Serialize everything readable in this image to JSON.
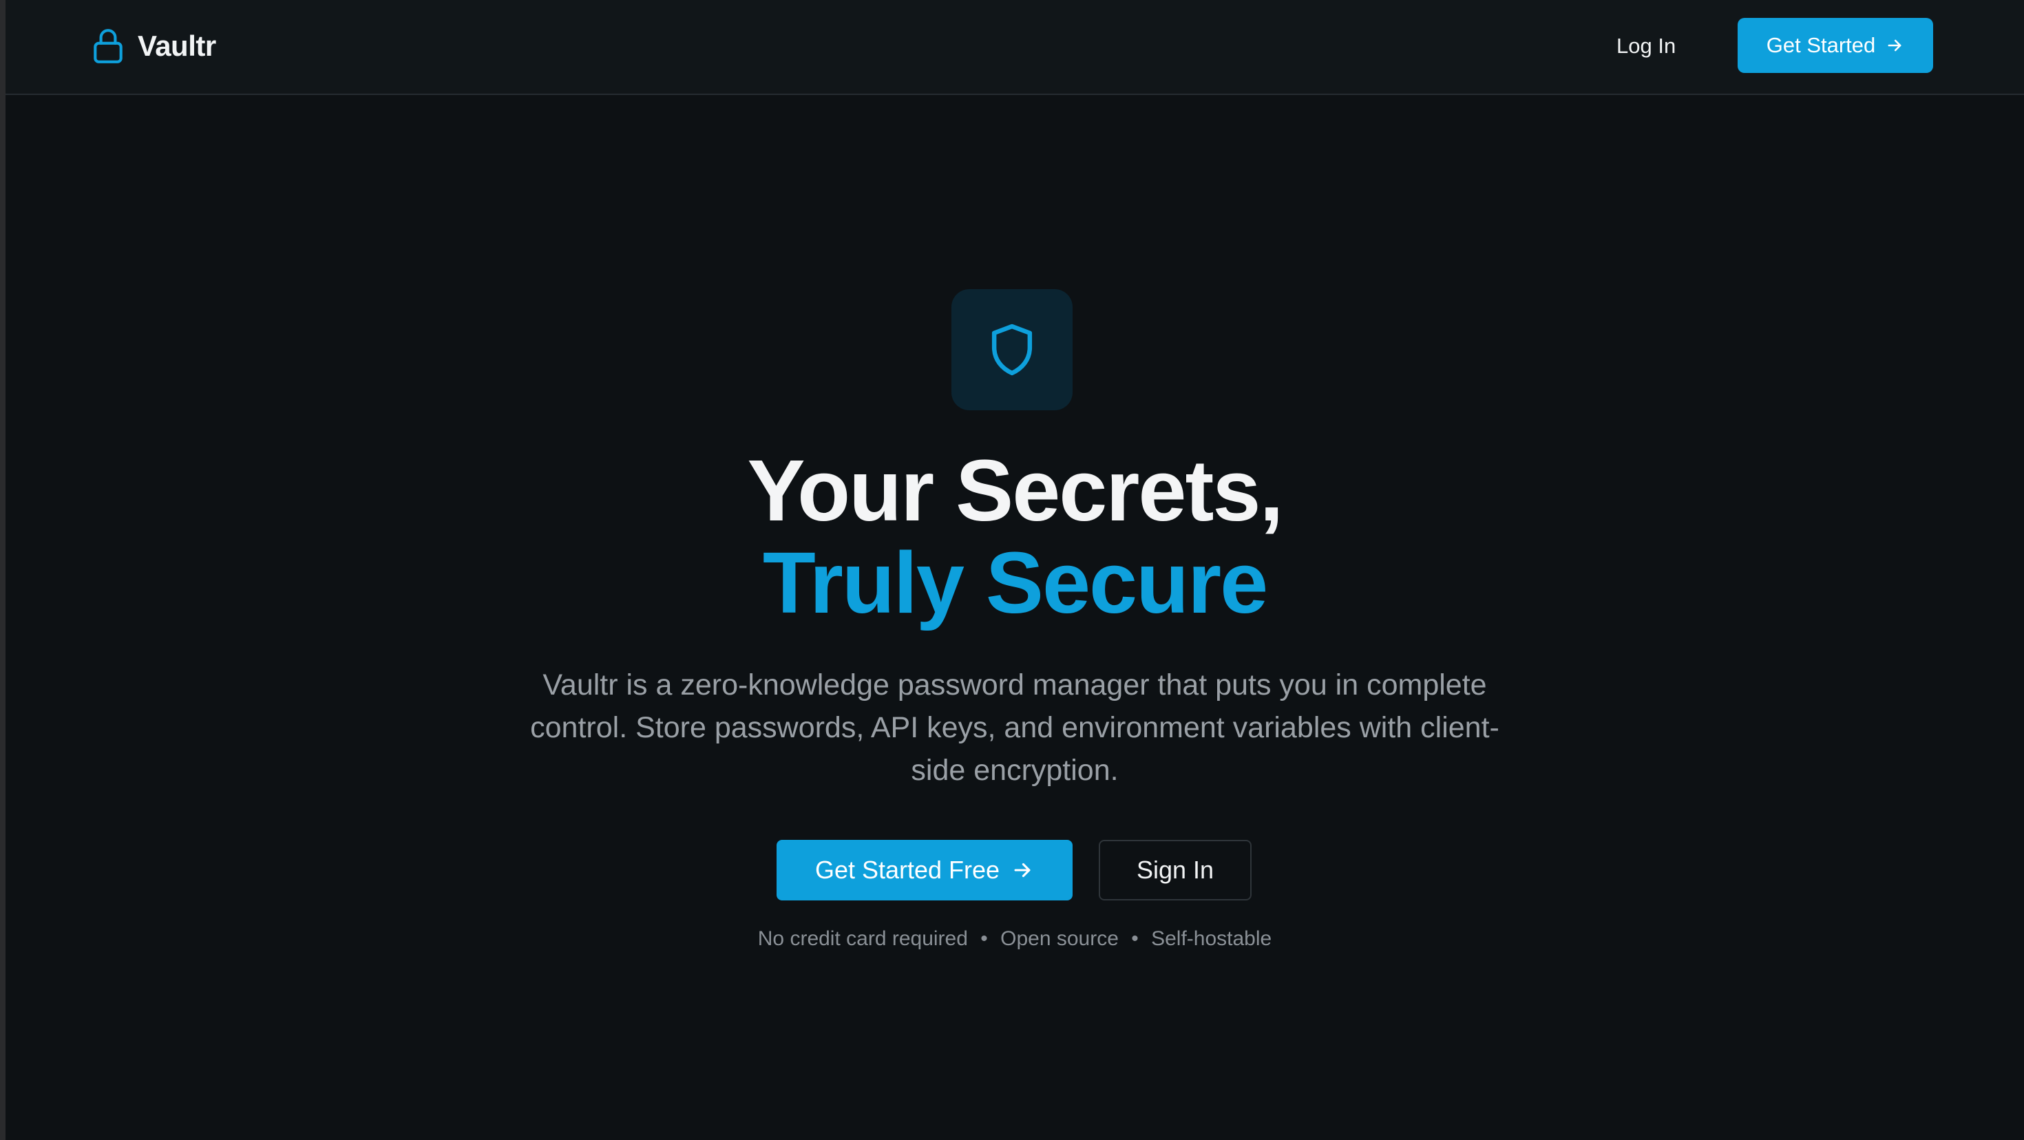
{
  "colors": {
    "accent": "#0ea0dc",
    "background": "#0d1114",
    "navbar": "#111619",
    "muted_text": "#9aa0a6"
  },
  "header": {
    "brand_icon": "lock-icon",
    "brand_name": "Vaultr",
    "login_label": "Log In",
    "cta_label": "Get Started",
    "cta_icon": "arrow-right-icon"
  },
  "hero": {
    "icon": "shield-icon",
    "title_line1": "Your Secrets,",
    "title_line2": "Truly Secure",
    "description": "Vaultr is a zero-knowledge password manager that puts you in complete control. Store passwords, API keys, and environment variables with client-side encryption.",
    "primary_cta": "Get Started Free",
    "primary_cta_icon": "arrow-right-icon",
    "secondary_cta": "Sign In",
    "features": [
      "No credit card required",
      "Open source",
      "Self-hostable"
    ],
    "separator": "•"
  }
}
